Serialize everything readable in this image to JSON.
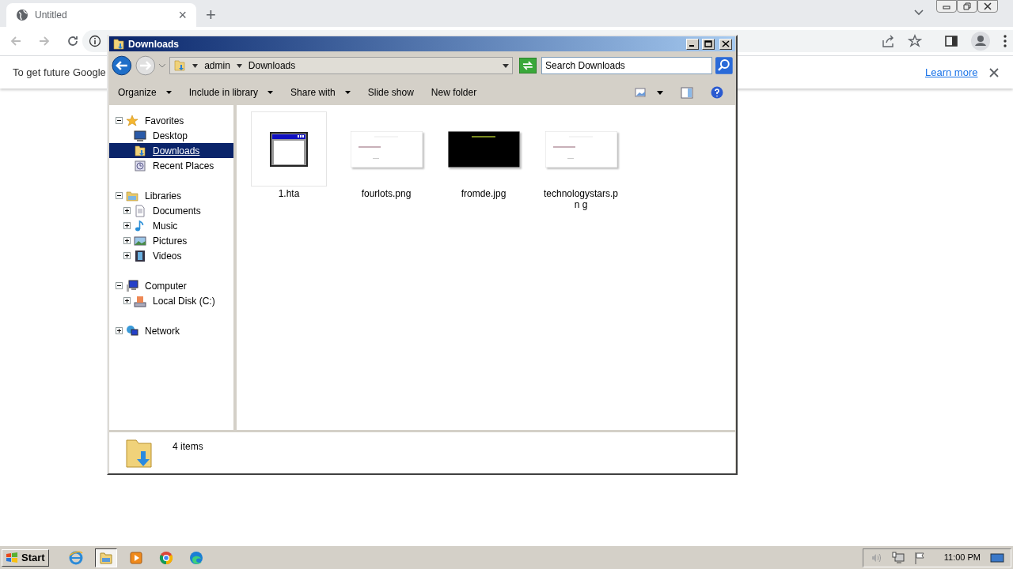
{
  "browser": {
    "tab": {
      "title": "Untitled",
      "close": "×"
    },
    "new_tab": "+",
    "infobar": {
      "text": "To get future Google",
      "link": "Learn more"
    }
  },
  "explorer": {
    "title": "Downloads",
    "breadcrumb": [
      "admin",
      "Downloads"
    ],
    "search": {
      "placeholder": "Search Downloads"
    },
    "toolbar": [
      {
        "label": "Organize",
        "dropdown": true
      },
      {
        "label": "Include in library",
        "dropdown": true
      },
      {
        "label": "Share with",
        "dropdown": true
      },
      {
        "label": "Slide show",
        "dropdown": false
      },
      {
        "label": "New folder",
        "dropdown": false
      }
    ],
    "nav": [
      {
        "label": "Favorites",
        "kind": "star",
        "expanded": true,
        "selected": false,
        "children": [
          {
            "label": "Desktop",
            "kind": "desktop",
            "selected": false
          },
          {
            "label": "Downloads",
            "kind": "downloads",
            "selected": true
          },
          {
            "label": "Recent Places",
            "kind": "recent",
            "selected": false
          }
        ]
      },
      {
        "label": "Libraries",
        "kind": "library",
        "expanded": true,
        "selected": false,
        "children": [
          {
            "label": "Documents",
            "kind": "document",
            "expanded": false,
            "selected": false
          },
          {
            "label": "Music",
            "kind": "music",
            "expanded": false,
            "selected": false
          },
          {
            "label": "Pictures",
            "kind": "pictures",
            "expanded": false,
            "selected": false
          },
          {
            "label": "Videos",
            "kind": "videos",
            "expanded": false,
            "selected": false
          }
        ]
      },
      {
        "label": "Computer",
        "kind": "computer",
        "expanded": true,
        "selected": false,
        "children": [
          {
            "label": "Local Disk (C:)",
            "kind": "disk",
            "expanded": false,
            "selected": false
          }
        ]
      },
      {
        "label": "Network",
        "kind": "network",
        "expanded": false,
        "selected": false
      }
    ],
    "files": [
      {
        "name": "1.hta",
        "kind": "app"
      },
      {
        "name": "fourlots.png",
        "kind": "light"
      },
      {
        "name": "fromde.jpg",
        "kind": "dark"
      },
      {
        "name": "technologystars.pn g",
        "kind": "light"
      }
    ],
    "status": "4 items"
  },
  "taskbar": {
    "start": "Start",
    "apps": [
      {
        "kind": "ie",
        "selected": false
      },
      {
        "kind": "explorer",
        "selected": true
      },
      {
        "kind": "media",
        "selected": false
      },
      {
        "kind": "chrome",
        "selected": false
      },
      {
        "kind": "edge",
        "selected": false
      }
    ],
    "clock": "11:00 PM"
  }
}
